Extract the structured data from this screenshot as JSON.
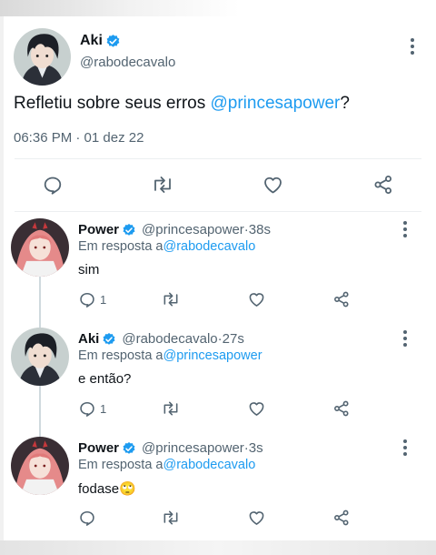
{
  "main_tweet": {
    "name": "Aki",
    "handle": "@rabodecavalo",
    "text_prefix": "Refletiu sobre seus erros ",
    "text_mention": "@princesapower",
    "text_suffix": "?",
    "timestamp": "06:36 PM · 01 dez 22",
    "icons": [
      "reply-icon",
      "retweet-icon",
      "like-icon",
      "share-icon"
    ]
  },
  "replies": [
    {
      "name": "Power",
      "handle": "@princesapower",
      "sep": " · ",
      "time": "38s",
      "replying_label": "Em resposta a ",
      "replying_to": "@rabodecavalo",
      "text": "sim",
      "reply_count": "1"
    },
    {
      "name": "Aki",
      "handle": "@rabodecavalo",
      "sep": " · ",
      "time": "27s",
      "replying_label": "Em resposta a ",
      "replying_to": "@princesapower",
      "text": "e então?",
      "reply_count": "1"
    },
    {
      "name": "Power",
      "handle": "@princesapower",
      "sep": " · ",
      "time": "3s",
      "replying_label": "Em resposta a ",
      "replying_to": "@rabodecavalo",
      "text": "fodase🙄",
      "reply_count": ""
    }
  ],
  "colors": {
    "accent": "#1d9bf0",
    "muted": "#536471",
    "text": "#0f1419",
    "divider": "#eceff1",
    "thread_line": "#cfd9de"
  }
}
